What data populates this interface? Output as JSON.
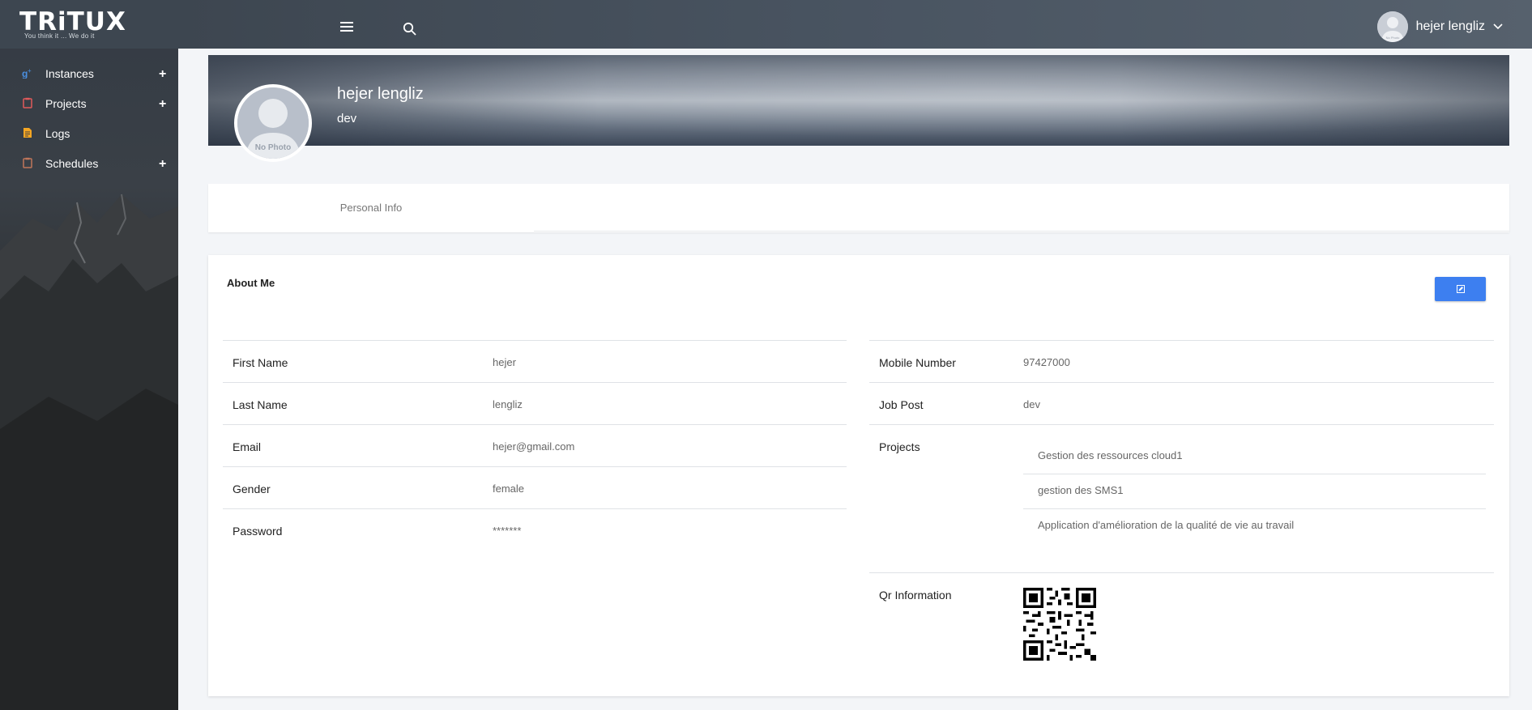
{
  "brand": {
    "name": "TRiTUX",
    "tagline": "You think it ... We do it"
  },
  "sidebar": {
    "items": [
      {
        "label": "Instances",
        "icon": "google-plus-icon",
        "color": "#4a90e2",
        "expandable": true
      },
      {
        "label": "Projects",
        "icon": "clipboard-icon",
        "color": "#e05a5a",
        "expandable": true
      },
      {
        "label": "Logs",
        "icon": "document-icon",
        "color": "#f5a623",
        "expandable": false
      },
      {
        "label": "Schedules",
        "icon": "clipboard-icon",
        "color": "#c0765a",
        "expandable": true
      }
    ]
  },
  "topbar": {
    "user_name": "hejer lengliz",
    "avatar_text": "No Photo"
  },
  "profile": {
    "name": "hejer lengliz",
    "role": "dev",
    "avatar_text": "No Photo"
  },
  "tabs": [
    {
      "label": "Personal Info"
    }
  ],
  "about": {
    "title": "About Me",
    "left": [
      {
        "label": "First Name",
        "value": "hejer"
      },
      {
        "label": "Last Name",
        "value": "lengliz"
      },
      {
        "label": "Email",
        "value": "hejer@gmail.com"
      },
      {
        "label": "Gender",
        "value": "female"
      },
      {
        "label": "Password",
        "value": "*******"
      }
    ],
    "right": [
      {
        "label": "Mobile Number",
        "value": "97427000"
      },
      {
        "label": "Job Post",
        "value": "dev"
      }
    ],
    "projects_label": "Projects",
    "projects": [
      "Gestion des ressources cloud1",
      "gestion des SMS1",
      "Application d'amélioration de la qualité de vie au travail"
    ],
    "qr_label": "Qr Information"
  },
  "colors": {
    "accent": "#3d7ff0",
    "sidebar_bg": "#2b2e31",
    "topbar_bg": "#3d4650"
  }
}
